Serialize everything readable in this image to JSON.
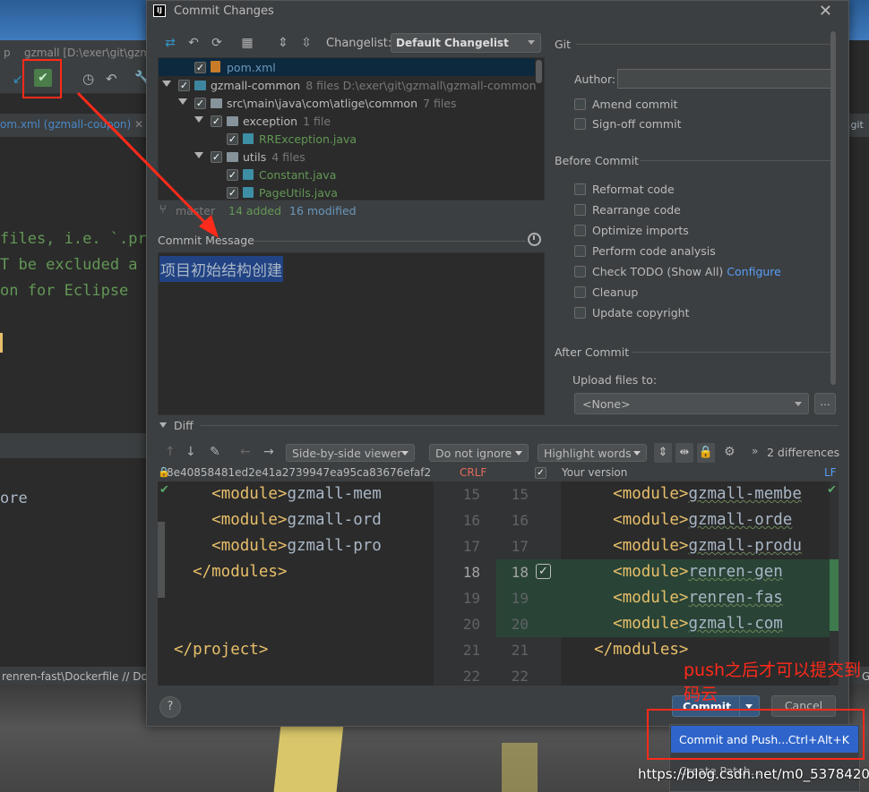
{
  "background": {
    "window_title": "gzmall [D:\\exer\\git\\gzma",
    "window_title_prefix": "p",
    "editor_tab": "om.xml (gzmall-coupon)",
    "right_tab": ".git",
    "code_lines": [
      "files, i.e. `.pr",
      "T be excluded a",
      "on for Eclipse"
    ],
    "lower_code": "ore",
    "status_bar": "renren-fast\\Dockerfile // Do",
    "status_bar_right": "G"
  },
  "dialog": {
    "title": "Commit Changes",
    "app_icon": "IJ",
    "close_glyph": "✕",
    "changelist_label": "Changelist:",
    "changelist_value": "Default Changelist",
    "tree": [
      {
        "name": "pom.xml",
        "count": "",
        "path": "",
        "icon": "xml",
        "color": "blue",
        "indent": 40,
        "toggle": false,
        "selected": true
      },
      {
        "name": "gzmall-common",
        "count": "8 files",
        "path": "D:\\exer\\git\\gzmall\\gzmall-common",
        "icon": "mod",
        "color": "normal",
        "indent": 4,
        "toggle": true,
        "selected": false
      },
      {
        "name": "src\\main\\java\\com\\atlige\\common",
        "count": "7 files",
        "path": "",
        "icon": "folder",
        "color": "normal",
        "indent": 22,
        "toggle": true,
        "selected": false
      },
      {
        "name": "exception",
        "count": "1 file",
        "path": "",
        "icon": "folder",
        "color": "normal",
        "indent": 40,
        "toggle": true,
        "selected": false
      },
      {
        "name": "RRException.java",
        "count": "",
        "path": "",
        "icon": "java",
        "color": "green",
        "indent": 76,
        "toggle": false,
        "selected": false
      },
      {
        "name": "utils",
        "count": "4 files",
        "path": "",
        "icon": "folder",
        "color": "normal",
        "indent": 40,
        "toggle": true,
        "selected": false
      },
      {
        "name": "Constant.java",
        "count": "",
        "path": "",
        "icon": "java",
        "color": "green",
        "indent": 76,
        "toggle": false,
        "selected": false
      },
      {
        "name": "PageUtils.java",
        "count": "",
        "path": "",
        "icon": "java",
        "color": "green",
        "indent": 76,
        "toggle": false,
        "selected": false
      }
    ],
    "branch": {
      "name": "master",
      "added": "14 added",
      "modified": "16 modified"
    },
    "commit_message_label": "Commit Message",
    "commit_message": "项目初始结构创建",
    "git_section": "Git",
    "author_label": "Author:",
    "author_value": "",
    "git_options": [
      "Amend commit",
      "Sign-off commit"
    ],
    "before_commit_section": "Before Commit",
    "before_options": [
      {
        "label": "Reformat code",
        "link": ""
      },
      {
        "label": "Rearrange code",
        "link": ""
      },
      {
        "label": "Optimize imports",
        "link": ""
      },
      {
        "label": "Perform code analysis",
        "link": ""
      },
      {
        "label": "Check TODO (Show All)",
        "link": "Configure"
      },
      {
        "label": "Cleanup",
        "link": ""
      },
      {
        "label": "Update copyright",
        "link": ""
      }
    ],
    "after_commit_section": "After Commit",
    "upload_label": "Upload files to:",
    "upload_value": "<None>",
    "upload_more": "...",
    "diff_label": "Diff",
    "diff_toolbar": {
      "viewer": "Side-by-side viewer",
      "ignore": "Do not ignore",
      "highlight": "Highlight words",
      "differences": "2 differences",
      "more": "»"
    },
    "diff_info": {
      "hash": "8e40858481ed2e41a2739947ea95ca83676efaf2",
      "left_sep": "CRLF",
      "right_title": "Your version",
      "right_sep": "LF"
    },
    "diff_left": [
      {
        "n": "15",
        "indent": "    ",
        "tag": "<module>",
        "text": "gzmall-mem",
        "added": false
      },
      {
        "n": "16",
        "indent": "    ",
        "tag": "<module>",
        "text": "gzmall-ord",
        "added": false
      },
      {
        "n": "17",
        "indent": "    ",
        "tag": "<module>",
        "text": "gzmall-pro",
        "added": false
      },
      {
        "n": "18",
        "indent": "  ",
        "tag": "</modules>",
        "text": "",
        "added": false
      },
      {
        "n": "19",
        "indent": "",
        "tag": "",
        "text": "",
        "added": false
      },
      {
        "n": "20",
        "indent": "",
        "tag": "",
        "text": "",
        "added": false
      },
      {
        "n": "21",
        "indent": "",
        "tag": "</project>",
        "text": "",
        "added": false
      },
      {
        "n": "22",
        "indent": "",
        "tag": "",
        "text": "",
        "added": false
      }
    ],
    "diff_right": [
      {
        "n": "15",
        "indent": "    ",
        "tag": "<module>",
        "text": "gzmall-membe",
        "added": false
      },
      {
        "n": "16",
        "indent": "    ",
        "tag": "<module>",
        "text": "gzmall-orde",
        "added": false
      },
      {
        "n": "17",
        "indent": "    ",
        "tag": "<module>",
        "text": "gzmall-produ",
        "added": false
      },
      {
        "n": "18",
        "indent": "    ",
        "tag": "<module>",
        "text": "renren-gen",
        "added": true
      },
      {
        "n": "19",
        "indent": "    ",
        "tag": "<module>",
        "text": "renren-fas",
        "added": true
      },
      {
        "n": "20",
        "indent": "    ",
        "tag": "<module>",
        "text": "gzmall-com",
        "added": true
      },
      {
        "n": "21",
        "indent": "  ",
        "tag": "</modules>",
        "text": "",
        "added": false
      },
      {
        "n": "22",
        "indent": "",
        "tag": "",
        "text": "",
        "added": false
      }
    ],
    "help": "?",
    "commit_button": "Commit",
    "cancel_button": "Cancel"
  },
  "popup": {
    "item1_label": "Commit and Push...",
    "item1_shortcut": "Ctrl+Alt+K",
    "item2_label": "Create Patch..."
  },
  "annotation": {
    "note": "push之后才可以提交到码云",
    "color": "#ff2a1a"
  },
  "watermark": "https://blog.csdn.net/m0_53784206"
}
